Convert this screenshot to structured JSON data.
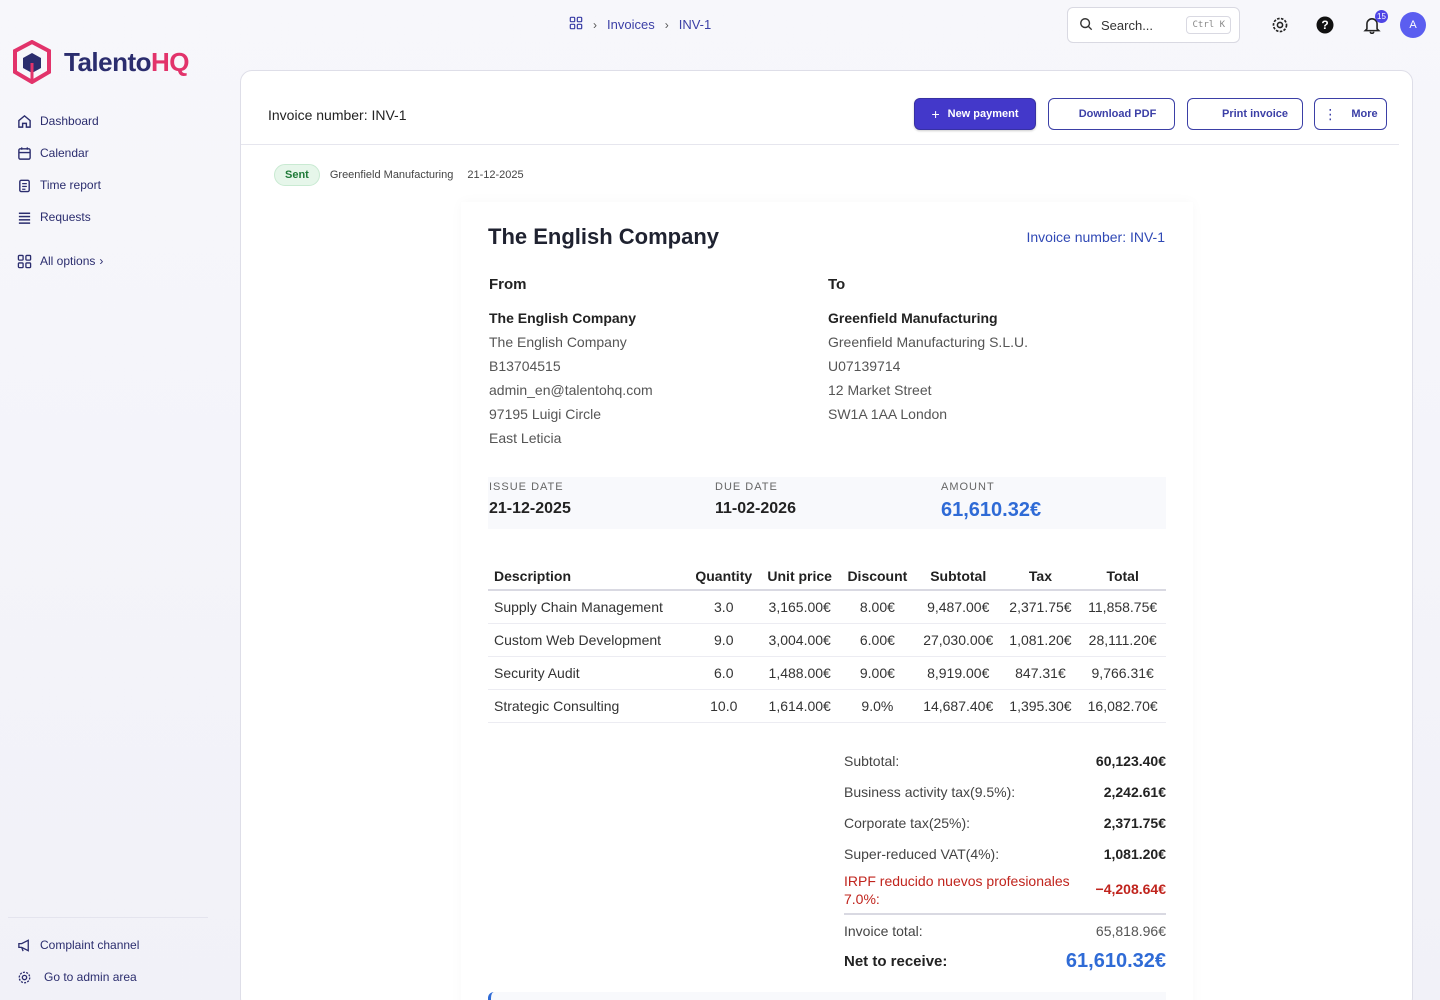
{
  "brand": {
    "name_main": "Talento",
    "name_accent": "HQ",
    "primary": "#2b2d6e",
    "accent": "#e2336b"
  },
  "sidebar": {
    "items": [
      {
        "label": "Dashboard",
        "icon": "home-icon"
      },
      {
        "label": "Calendar",
        "icon": "calendar-icon"
      },
      {
        "label": "Time report",
        "icon": "clipboard-icon"
      },
      {
        "label": "Requests",
        "icon": "list-icon"
      }
    ],
    "all_options": "All options",
    "bottom": [
      {
        "label": "Complaint channel",
        "icon": "megaphone-icon"
      },
      {
        "label": "Go to admin area",
        "icon": "gear-icon"
      }
    ]
  },
  "topbar": {
    "breadcrumb": [
      "Invoices",
      "INV-1"
    ],
    "search_placeholder": "Search...",
    "search_shortcut": "Ctrl K",
    "notifications_count": "15",
    "avatar_initial": "A"
  },
  "header": {
    "title": "Invoice number: INV-1",
    "actions": {
      "new_payment": "New payment",
      "download_pdf": "Download PDF",
      "print_invoice": "Print invoice",
      "more": "More"
    }
  },
  "meta": {
    "status": "Sent",
    "client": "Greenfield Manufacturing",
    "date": "21-12-2025"
  },
  "invoice": {
    "company": "The English Company",
    "number_label": "Invoice number: INV-1",
    "from": {
      "heading": "From",
      "name": "The English Company",
      "lines": [
        "The English Company",
        "B13704515",
        "admin_en@talentohq.com",
        "97195 Luigi Circle",
        "East Leticia"
      ]
    },
    "to": {
      "heading": "To",
      "name": "Greenfield Manufacturing",
      "lines": [
        "Greenfield Manufacturing S.L.U.",
        "U07139714",
        "12 Market Street",
        "SW1A 1AA London"
      ]
    },
    "issue_date_label": "ISSUE DATE",
    "issue_date": "21-12-2025",
    "due_date_label": "DUE DATE",
    "due_date": "11-02-2026",
    "amount_label": "AMOUNT",
    "amount": "61,610.32€",
    "columns": [
      "Description",
      "Quantity",
      "Unit price",
      "Discount",
      "Subtotal",
      "Tax",
      "Total"
    ],
    "rows": [
      [
        "Supply Chain Management",
        "3.0",
        "3,165.00€",
        "8.00€",
        "9,487.00€",
        "2,371.75€",
        "11,858.75€"
      ],
      [
        "Custom Web Development",
        "9.0",
        "3,004.00€",
        "6.00€",
        "27,030.00€",
        "1,081.20€",
        "28,111.20€"
      ],
      [
        "Security Audit",
        "6.0",
        "1,488.00€",
        "9.00€",
        "8,919.00€",
        "847.31€",
        "9,766.31€"
      ],
      [
        "Strategic Consulting",
        "10.0",
        "1,614.00€",
        "9.0%",
        "14,687.40€",
        "1,395.30€",
        "16,082.70€"
      ]
    ],
    "totals": {
      "subtotal_label": "Subtotal:",
      "subtotal": "60,123.40€",
      "bat_label": "Business activity tax(9.5%):",
      "bat": "2,242.61€",
      "corp_label": "Corporate tax(25%):",
      "corp": "2,371.75€",
      "vat_label": "Super-reduced VAT(4%):",
      "vat": "1,081.20€",
      "irpf_label": "IRPF reducido nuevos profesionales 7.0%:",
      "irpf": "−4,208.64€",
      "invoice_total_label": "Invoice total:",
      "invoice_total": "65,818.96€",
      "net_label": "Net to receive:",
      "net": "61,610.32€"
    }
  }
}
